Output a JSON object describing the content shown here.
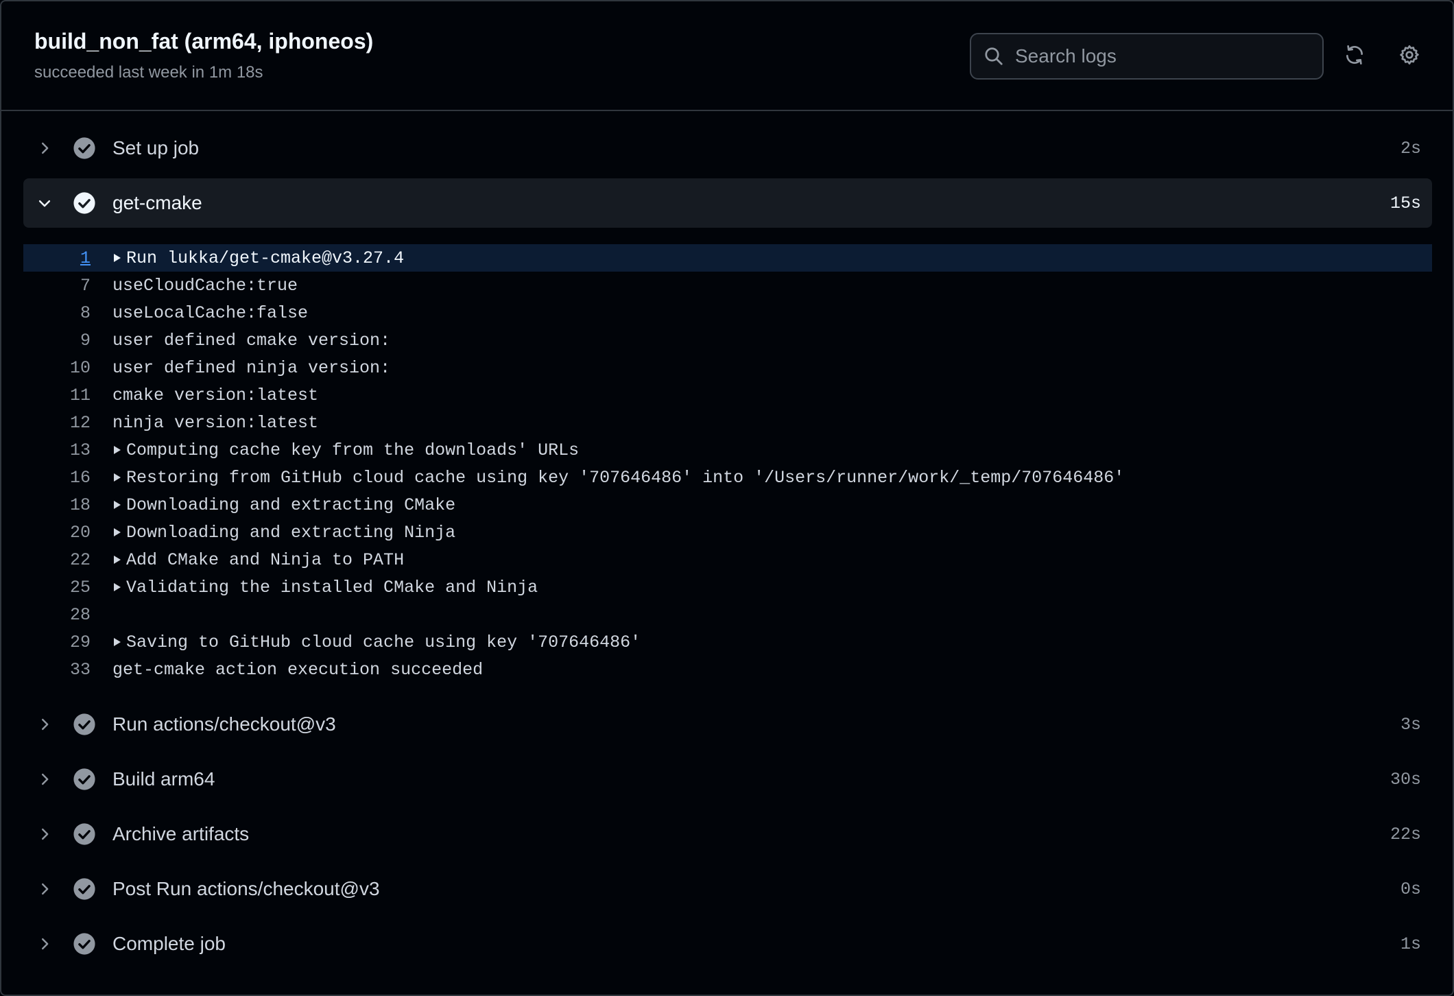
{
  "header": {
    "title": "build_non_fat (arm64, iphoneos)",
    "subtitle": "succeeded last week in 1m 18s",
    "search_placeholder": "Search logs",
    "refresh_icon": "refresh-icon",
    "settings_icon": "gear-icon"
  },
  "colors": {
    "background": "#010409",
    "expanded_row": "#161b22",
    "highlight_line": "#0c1c33",
    "link": "#4493f8",
    "muted_text": "#9198a1",
    "check_bg_muted": "#9198a1",
    "check_bg_active": "#f0f6fc"
  },
  "steps": [
    {
      "name": "Set up job",
      "duration": "2s",
      "expanded": false
    },
    {
      "name": "get-cmake",
      "duration": "15s",
      "expanded": true
    },
    {
      "name": "Run actions/checkout@v3",
      "duration": "3s",
      "expanded": false
    },
    {
      "name": "Build arm64",
      "duration": "30s",
      "expanded": false
    },
    {
      "name": "Archive artifacts",
      "duration": "22s",
      "expanded": false
    },
    {
      "name": "Post Run actions/checkout@v3",
      "duration": "0s",
      "expanded": false
    },
    {
      "name": "Complete job",
      "duration": "1s",
      "expanded": false
    }
  ],
  "log_lines": [
    {
      "num": "1",
      "text": "Run lukka/get-cmake@v3.27.4",
      "group": true,
      "highlight": true
    },
    {
      "num": "7",
      "text": "useCloudCache:true",
      "group": false
    },
    {
      "num": "8",
      "text": "useLocalCache:false",
      "group": false
    },
    {
      "num": "9",
      "text": "user defined cmake version:",
      "group": false
    },
    {
      "num": "10",
      "text": "user defined ninja version:",
      "group": false
    },
    {
      "num": "11",
      "text": "cmake version:latest",
      "group": false
    },
    {
      "num": "12",
      "text": "ninja version:latest",
      "group": false
    },
    {
      "num": "13",
      "text": "Computing cache key from the downloads' URLs",
      "group": true
    },
    {
      "num": "16",
      "text": "Restoring from GitHub cloud cache using key '707646486' into '/Users/runner/work/_temp/707646486'",
      "group": true
    },
    {
      "num": "18",
      "text": "Downloading and extracting CMake",
      "group": true
    },
    {
      "num": "20",
      "text": "Downloading and extracting Ninja",
      "group": true
    },
    {
      "num": "22",
      "text": "Add CMake and Ninja to PATH",
      "group": true
    },
    {
      "num": "25",
      "text": "Validating the installed CMake and Ninja",
      "group": true
    },
    {
      "num": "28",
      "text": "",
      "group": false
    },
    {
      "num": "29",
      "text": "Saving to GitHub cloud cache using key '707646486'",
      "group": true
    },
    {
      "num": "33",
      "text": "get-cmake action execution succeeded",
      "group": false
    }
  ]
}
